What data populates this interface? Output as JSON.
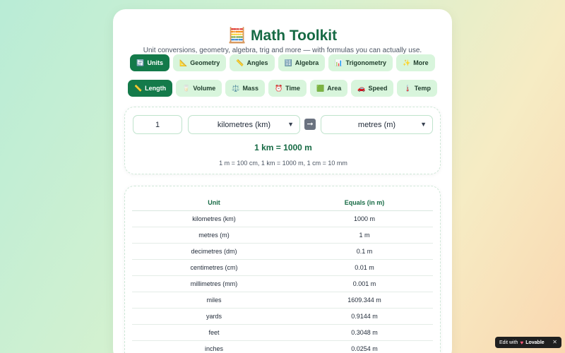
{
  "header": {
    "logo_icon": "🧮",
    "title": "Math Toolkit",
    "subtitle": "Unit conversions, geometry, algebra, trig and more — with formulas you can actually use."
  },
  "categories": [
    {
      "icon": "🔄",
      "label": "Units",
      "active": true
    },
    {
      "icon": "📐",
      "label": "Geometry",
      "active": false
    },
    {
      "icon": "📏",
      "label": "Angles",
      "active": false
    },
    {
      "icon": "🔢",
      "label": "Algebra",
      "active": false
    },
    {
      "icon": "📊",
      "label": "Trigonometry",
      "active": false
    },
    {
      "icon": "✨",
      "label": "More",
      "active": false
    }
  ],
  "unit_types": [
    {
      "icon": "📏",
      "label": "Length",
      "active": true
    },
    {
      "icon": "🥛",
      "label": "Volume",
      "active": false
    },
    {
      "icon": "⚖️",
      "label": "Mass",
      "active": false
    },
    {
      "icon": "⏰",
      "label": "Time",
      "active": false
    },
    {
      "icon": "🟩",
      "label": "Area",
      "active": false
    },
    {
      "icon": "🚗",
      "label": "Speed",
      "active": false
    },
    {
      "icon": "🌡️",
      "label": "Temp",
      "active": false
    }
  ],
  "converter": {
    "amount": "1",
    "from_unit": "kilometres (km)",
    "swap_icon": "➡️",
    "to_unit": "metres (m)",
    "result": "1 km = 1000 m",
    "formula": "1 m = 100 cm, 1 km = 1000 m, 1 cm = 10 mm"
  },
  "table": {
    "headers": [
      "Unit",
      "Equals (in m)"
    ],
    "rows": [
      [
        "kilometres (km)",
        "1000 m"
      ],
      [
        "metres (m)",
        "1 m"
      ],
      [
        "decimetres (dm)",
        "0.1 m"
      ],
      [
        "centimetres (cm)",
        "0.01 m"
      ],
      [
        "millimetres (mm)",
        "0.001 m"
      ],
      [
        "miles",
        "1609.344 m"
      ],
      [
        "yards",
        "0.9144 m"
      ],
      [
        "feet",
        "0.3048 m"
      ],
      [
        "inches",
        "0.0254 m"
      ]
    ]
  },
  "badge": {
    "text": "Edit with",
    "brand": "Lovable",
    "close": "✕"
  }
}
